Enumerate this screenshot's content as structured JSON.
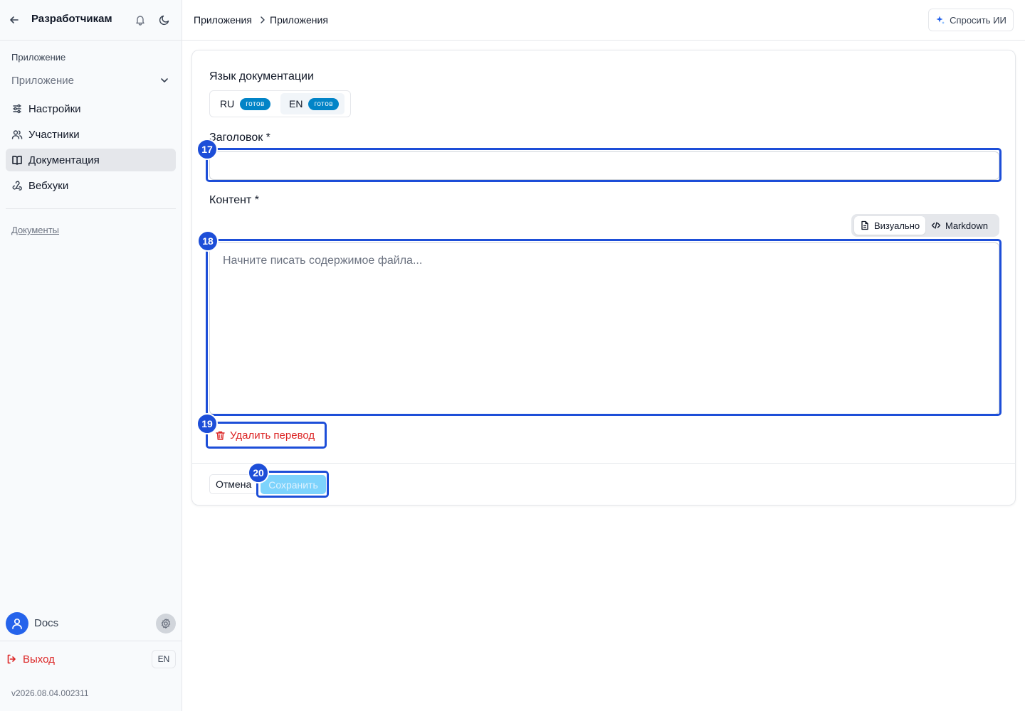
{
  "sidebar": {
    "title": "Разработчикам",
    "section_label": "Приложение",
    "app_select_value": "Приложение",
    "nav": [
      {
        "label": "Настройки",
        "icon": "settings-icon"
      },
      {
        "label": "Участники",
        "icon": "users-icon"
      },
      {
        "label": "Документация",
        "icon": "book-icon",
        "active": true
      },
      {
        "label": "Вебхуки",
        "icon": "webhook-icon"
      }
    ],
    "docs_link": "Документы",
    "user_name": "Docs",
    "logout_label": "Выход",
    "lang_button": "EN",
    "version": "v2026.08.04.002311"
  },
  "topbar": {
    "breadcrumb": [
      "Приложения",
      "Приложения"
    ],
    "ask_ai_label": "Спросить ИИ"
  },
  "form": {
    "doc_language_label": "Язык документации",
    "lang_tabs": [
      {
        "code": "RU",
        "status": "готов"
      },
      {
        "code": "EN",
        "status": "готов",
        "active": true
      }
    ],
    "title_label": "Заголовок *",
    "title_value": "",
    "content_label": "Контент *",
    "mode_visual_label": "Визуально",
    "mode_markdown_label": "Markdown",
    "content_placeholder": "Начните писать содержимое файла...",
    "delete_translation_label": "Удалить перевод",
    "cancel_label": "Отмена",
    "save_label": "Сохранить"
  },
  "annotations": {
    "title_marker": "17",
    "content_marker": "18",
    "delete_marker": "19",
    "save_marker": "20"
  },
  "colors": {
    "accent": "#1d4ed8",
    "badge": "#0284c7",
    "danger": "#dc2626",
    "save_disabled": "#7dd3fc",
    "avatar": "#2563eb"
  }
}
